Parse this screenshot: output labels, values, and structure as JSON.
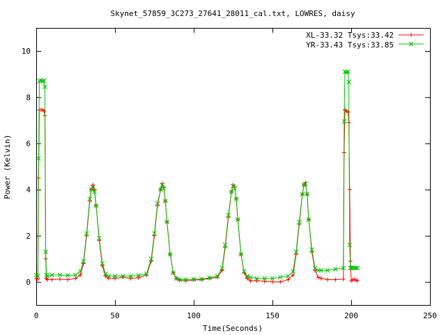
{
  "chart_data": {
    "type": "scatter",
    "title": "Skynet_57859_3C273_27641_28011_cal.txt, LOWRES, daisy",
    "xlabel": "Time(Seconds)",
    "ylabel": "Power (Kelvin)",
    "xlim": [
      0,
      250
    ],
    "ylim": [
      -1,
      11
    ],
    "xticks": [
      "0",
      "50",
      "100",
      "150",
      "200",
      "250"
    ],
    "yticks": [
      "0",
      "2",
      "4",
      "6",
      "8",
      "10"
    ],
    "ytick_values": [
      0,
      2,
      4,
      6,
      8,
      10
    ],
    "xtick_values": [
      0,
      50,
      100,
      150,
      200,
      250
    ],
    "grid": false,
    "legend_position": "top-right",
    "series": [
      {
        "name": "XL-33.32 Tsys:33.42",
        "color": "#ff0000",
        "marker": "plus",
        "x": [
          0,
          1,
          1.5,
          2,
          3,
          4,
          5,
          5.5,
          6,
          6.5,
          7,
          10,
          15,
          20,
          25,
          28,
          30,
          32,
          34,
          35,
          36,
          37,
          38,
          40,
          42,
          44,
          46,
          50,
          55,
          60,
          65,
          70,
          73,
          75,
          77,
          79,
          80,
          81,
          82,
          83,
          85,
          87,
          89,
          91,
          95,
          100,
          105,
          110,
          115,
          118,
          120,
          122,
          124,
          125,
          126,
          127,
          128,
          130,
          132,
          134,
          136,
          140,
          145,
          150,
          155,
          160,
          163,
          165,
          167,
          169,
          170,
          171,
          172,
          173,
          175,
          177,
          179,
          181,
          185,
          190,
          195,
          195.5,
          196,
          197,
          198,
          198.5,
          199,
          199.5,
          200,
          201,
          202,
          203,
          204
        ],
        "y": [
          0.15,
          0.12,
          4.5,
          7.45,
          7.45,
          7.45,
          7.4,
          7.2,
          1.0,
          0.15,
          0.1,
          0.1,
          0.12,
          0.1,
          0.15,
          0.3,
          0.8,
          2.0,
          3.5,
          4.0,
          4.2,
          4.0,
          3.3,
          1.8,
          0.7,
          0.25,
          0.15,
          0.15,
          0.2,
          0.15,
          0.18,
          0.3,
          0.9,
          2.0,
          3.3,
          4.0,
          4.25,
          4.1,
          3.5,
          2.6,
          1.2,
          0.4,
          0.15,
          0.08,
          0.05,
          0.08,
          0.1,
          0.15,
          0.2,
          0.5,
          1.5,
          2.8,
          3.9,
          4.2,
          4.1,
          3.6,
          2.7,
          1.2,
          0.4,
          0.15,
          0.05,
          0.05,
          0.02,
          0.0,
          0.0,
          0.1,
          0.3,
          1.2,
          2.5,
          3.8,
          4.2,
          4.3,
          3.8,
          2.7,
          1.3,
          0.5,
          0.2,
          0.15,
          0.1,
          0.1,
          0.12,
          5.6,
          7.45,
          7.4,
          7.35,
          6.9,
          4.0,
          0.9,
          0.05,
          0.1,
          0.1,
          0.08,
          0.05
        ]
      },
      {
        "name": "YR-33.43 Tsys:33.85",
        "color": "#00c000",
        "marker": "cross",
        "x": [
          0,
          1,
          1.5,
          2,
          3,
          4,
          5,
          5.5,
          6,
          6.5,
          7,
          10,
          15,
          20,
          25,
          28,
          30,
          32,
          34,
          35,
          36,
          37,
          38,
          40,
          42,
          44,
          46,
          50,
          55,
          60,
          65,
          70,
          73,
          75,
          77,
          79,
          80,
          81,
          82,
          83,
          85,
          87,
          89,
          91,
          95,
          100,
          105,
          110,
          115,
          118,
          120,
          122,
          124,
          125,
          126,
          127,
          128,
          130,
          132,
          134,
          136,
          140,
          145,
          150,
          155,
          160,
          163,
          165,
          167,
          169,
          170,
          171,
          172,
          173,
          175,
          177,
          179,
          181,
          185,
          190,
          195,
          195.5,
          196,
          197,
          198,
          198.5,
          199,
          199.5,
          200,
          201,
          202,
          203,
          204
        ],
        "y": [
          0.3,
          0.25,
          5.35,
          8.7,
          8.72,
          8.7,
          8.72,
          8.45,
          1.3,
          0.3,
          0.25,
          0.3,
          0.3,
          0.28,
          0.3,
          0.45,
          0.9,
          2.1,
          3.6,
          4.0,
          4.1,
          3.9,
          3.3,
          1.9,
          0.8,
          0.35,
          0.25,
          0.25,
          0.25,
          0.25,
          0.28,
          0.35,
          1.0,
          2.1,
          3.4,
          4.0,
          4.2,
          4.05,
          3.5,
          2.6,
          1.2,
          0.4,
          0.15,
          0.1,
          0.1,
          0.12,
          0.12,
          0.18,
          0.25,
          0.6,
          1.6,
          2.9,
          3.9,
          4.15,
          4.05,
          3.6,
          2.7,
          1.2,
          0.45,
          0.25,
          0.2,
          0.15,
          0.15,
          0.15,
          0.2,
          0.25,
          0.45,
          1.3,
          2.6,
          3.8,
          4.2,
          4.25,
          3.8,
          2.7,
          1.4,
          0.6,
          0.5,
          0.5,
          0.5,
          0.55,
          0.6,
          6.95,
          9.1,
          9.08,
          9.1,
          8.65,
          1.6,
          0.6,
          0.6,
          0.62,
          0.6,
          0.6,
          0.6
        ]
      }
    ]
  }
}
